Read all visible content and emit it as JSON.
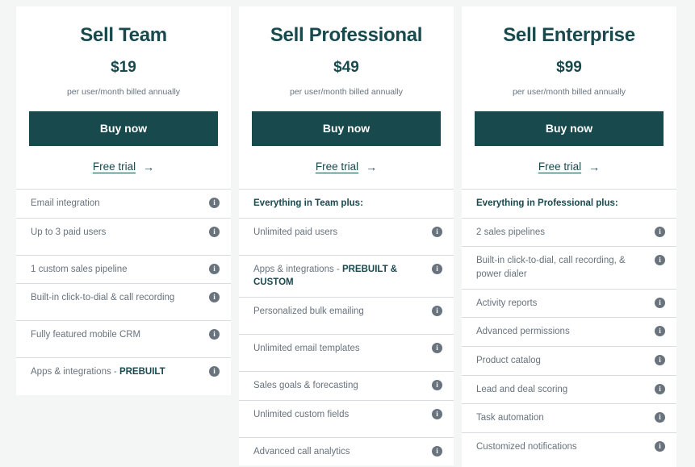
{
  "theme": {
    "accent": "#17494d",
    "page_background": "#f4f6f6",
    "card_background": "#ffffff",
    "muted_text": "#68737d",
    "divider": "#d8dcde"
  },
  "plans": [
    {
      "name": "Sell Team",
      "price": "$19",
      "billing": "per user/month billed annually",
      "buy_label": "Buy now",
      "trial_label": "Free trial",
      "trial_arrow": "→",
      "info_icon_glyph": "i",
      "features": [
        {
          "text": "Email integration",
          "heading": false,
          "emphasis": "",
          "info": true,
          "tall": false
        },
        {
          "text": "Up to 3 paid users",
          "heading": false,
          "emphasis": "",
          "info": true,
          "tall": true
        },
        {
          "text": "1 custom sales pipeline",
          "heading": false,
          "emphasis": "",
          "info": true,
          "tall": false
        },
        {
          "text": "Built-in click-to-dial & call recording",
          "heading": false,
          "emphasis": "",
          "info": true,
          "tall": true
        },
        {
          "text": "Fully featured mobile CRM",
          "heading": false,
          "emphasis": "",
          "info": true,
          "tall": true
        },
        {
          "text": "Apps & integrations - ",
          "heading": false,
          "emphasis": "PREBUILT",
          "info": true,
          "tall": true
        }
      ]
    },
    {
      "name": "Sell Professional",
      "price": "$49",
      "billing": "per user/month billed annually",
      "buy_label": "Buy now",
      "trial_label": "Free trial",
      "trial_arrow": "→",
      "info_icon_glyph": "i",
      "features": [
        {
          "text": "Everything in Team plus:",
          "heading": true,
          "emphasis": "",
          "info": false,
          "tall": false
        },
        {
          "text": "Unlimited paid users",
          "heading": false,
          "emphasis": "",
          "info": true,
          "tall": true
        },
        {
          "text": "Apps & integrations - ",
          "heading": false,
          "emphasis": "PREBUILT & CUSTOM",
          "info": true,
          "tall": false
        },
        {
          "text": "Personalized bulk emailing",
          "heading": false,
          "emphasis": "",
          "info": true,
          "tall": true
        },
        {
          "text": "Unlimited email templates",
          "heading": false,
          "emphasis": "",
          "info": true,
          "tall": true
        },
        {
          "text": "Sales goals & forecasting",
          "heading": false,
          "emphasis": "",
          "info": true,
          "tall": false
        },
        {
          "text": "Unlimited custom fields",
          "heading": false,
          "emphasis": "",
          "info": true,
          "tall": true
        },
        {
          "text": "Advanced call analytics",
          "heading": false,
          "emphasis": "",
          "info": true,
          "tall": false
        }
      ]
    },
    {
      "name": "Sell Enterprise",
      "price": "$99",
      "billing": "per user/month billed annually",
      "buy_label": "Buy now",
      "trial_label": "Free trial",
      "trial_arrow": "→",
      "info_icon_glyph": "i",
      "features": [
        {
          "text": "Everything in Professional plus:",
          "heading": true,
          "emphasis": "",
          "info": false,
          "tall": false
        },
        {
          "text": "2 sales pipelines",
          "heading": false,
          "emphasis": "",
          "info": true,
          "tall": false
        },
        {
          "text": "Built-in click-to-dial, call recording, & power dialer",
          "heading": false,
          "emphasis": "",
          "info": true,
          "tall": true
        },
        {
          "text": "Activity reports",
          "heading": false,
          "emphasis": "",
          "info": true,
          "tall": false
        },
        {
          "text": "Advanced permissions",
          "heading": false,
          "emphasis": "",
          "info": true,
          "tall": false
        },
        {
          "text": "Product catalog",
          "heading": false,
          "emphasis": "",
          "info": true,
          "tall": false
        },
        {
          "text": "Lead and deal scoring",
          "heading": false,
          "emphasis": "",
          "info": true,
          "tall": false
        },
        {
          "text": "Task automation",
          "heading": false,
          "emphasis": "",
          "info": true,
          "tall": false
        },
        {
          "text": "Customized notifications",
          "heading": false,
          "emphasis": "",
          "info": true,
          "tall": true
        }
      ]
    }
  ]
}
